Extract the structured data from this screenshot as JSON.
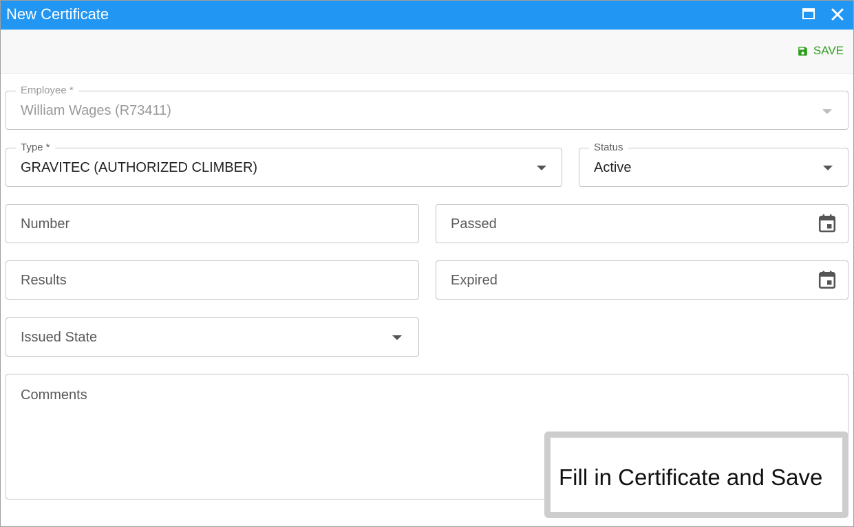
{
  "window": {
    "title": "New Certificate",
    "maximize_icon": "maximize-icon",
    "close_icon": "close-icon"
  },
  "toolbar": {
    "save_label": "SAVE",
    "save_icon": "floppy-disk-icon"
  },
  "form": {
    "employee": {
      "label": "Employee *",
      "value": "William Wages (R73411)",
      "disabled": true
    },
    "type": {
      "label": "Type *",
      "value": "GRAVITEC (AUTHORIZED CLIMBER)"
    },
    "status": {
      "label": "Status",
      "value": "Active"
    },
    "number": {
      "placeholder": "Number",
      "value": ""
    },
    "passed": {
      "placeholder": "Passed",
      "value": ""
    },
    "results": {
      "placeholder": "Results",
      "value": ""
    },
    "expired": {
      "placeholder": "Expired",
      "value": ""
    },
    "issued_state": {
      "placeholder": "Issued State",
      "value": ""
    },
    "comments": {
      "placeholder": "Comments",
      "value": ""
    }
  },
  "callout": {
    "text": "Fill in Certificate and Save"
  },
  "colors": {
    "titlebar": "#2196f3",
    "save": "#2e9e1e",
    "border": "#c4c4c4"
  }
}
